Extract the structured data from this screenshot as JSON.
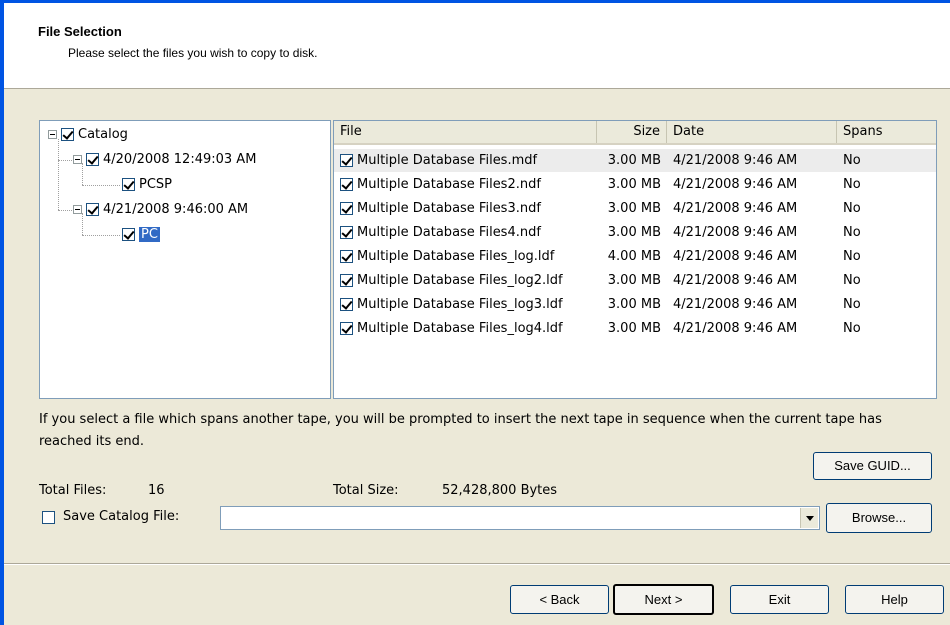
{
  "header": {
    "title": "File Selection",
    "subtitle": "Please select the files you wish to copy to disk."
  },
  "tree": {
    "root": {
      "label": "Catalog",
      "checked": true,
      "expanded": true
    },
    "sets": [
      {
        "label": "4/20/2008 12:49:03 AM",
        "checked": true,
        "expanded": true,
        "child": {
          "label": "PCSP",
          "checked": true
        }
      },
      {
        "label": "4/21/2008 9:46:00 AM",
        "checked": true,
        "expanded": true,
        "child": {
          "label": "PC",
          "checked": true,
          "selected": true
        }
      }
    ]
  },
  "file_list": {
    "columns": [
      "File",
      "Size",
      "Date",
      "Spans"
    ],
    "rows": [
      {
        "file": "Multiple Database Files.mdf",
        "size": "3.00 MB",
        "date": "4/21/2008 9:46 AM",
        "spans": "No",
        "checked": true
      },
      {
        "file": "Multiple Database Files2.ndf",
        "size": "3.00 MB",
        "date": "4/21/2008 9:46 AM",
        "spans": "No",
        "checked": true
      },
      {
        "file": "Multiple Database Files3.ndf",
        "size": "3.00 MB",
        "date": "4/21/2008 9:46 AM",
        "spans": "No",
        "checked": true
      },
      {
        "file": "Multiple Database Files4.ndf",
        "size": "3.00 MB",
        "date": "4/21/2008 9:46 AM",
        "spans": "No",
        "checked": true
      },
      {
        "file": "Multiple Database Files_log.ldf",
        "size": "4.00 MB",
        "date": "4/21/2008 9:46 AM",
        "spans": "No",
        "checked": true
      },
      {
        "file": "Multiple Database Files_log2.ldf",
        "size": "3.00 MB",
        "date": "4/21/2008 9:46 AM",
        "spans": "No",
        "checked": true
      },
      {
        "file": "Multiple Database Files_log3.ldf",
        "size": "3.00 MB",
        "date": "4/21/2008 9:46 AM",
        "spans": "No",
        "checked": true
      },
      {
        "file": "Multiple Database Files_log4.ldf",
        "size": "3.00 MB",
        "date": "4/21/2008 9:46 AM",
        "spans": "No",
        "checked": true
      }
    ]
  },
  "info_text": "If you select a file which spans another tape, you will be prompted to insert the next tape in sequence when the current tape has reached its end.",
  "buttons": {
    "save_guid": "Save GUID...",
    "browse": "Browse...",
    "back": "< Back",
    "next": "Next >",
    "exit": "Exit",
    "help": "Help"
  },
  "totals": {
    "files_label": "Total Files:",
    "files_value": "16",
    "size_label": "Total Size:",
    "size_value": "52,428,800 Bytes"
  },
  "save_catalog": {
    "label": "Save Catalog File:",
    "checked": false,
    "value": ""
  }
}
